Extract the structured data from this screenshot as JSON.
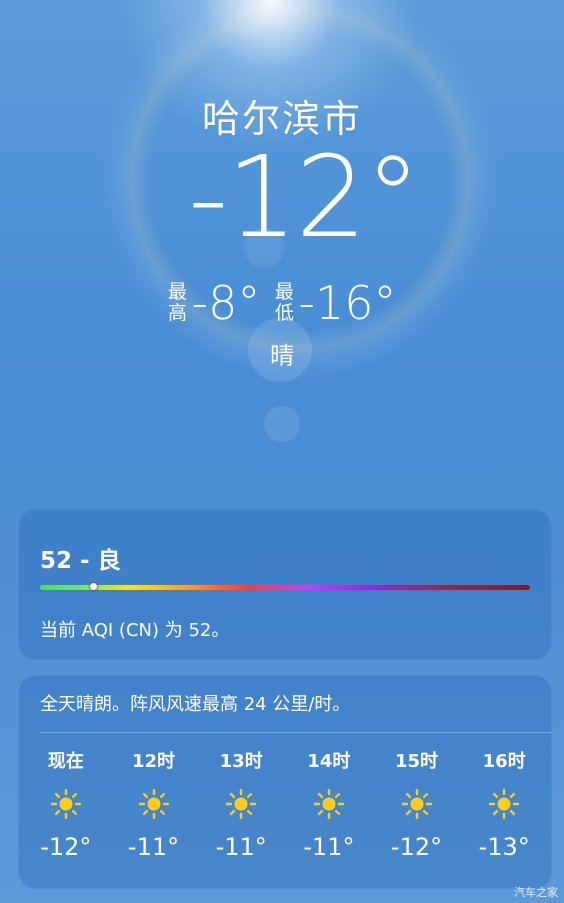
{
  "header": {
    "city": "哈尔滨市",
    "temperature": "-12°",
    "high_label": "最高",
    "high": "-8°",
    "low_label": "最低",
    "low": "-16°",
    "condition": "晴"
  },
  "aqi": {
    "value_text": "52 - 良",
    "description": "当前 AQI (CN) 为 52。",
    "level_fraction": 0.11
  },
  "forecast": {
    "summary": "全天晴朗。阵风风速最高 24 公里/时。",
    "hours": [
      {
        "label": "现在",
        "icon": "sun-icon",
        "temp": "-12°"
      },
      {
        "label": "12时",
        "icon": "sun-icon",
        "temp": "-11°"
      },
      {
        "label": "13时",
        "icon": "sun-icon",
        "temp": "-11°"
      },
      {
        "label": "14时",
        "icon": "sun-icon",
        "temp": "-11°"
      },
      {
        "label": "15时",
        "icon": "sun-icon",
        "temp": "-12°"
      },
      {
        "label": "16时",
        "icon": "sun-icon",
        "temp": "-13°"
      }
    ]
  },
  "watermark": "汽车之家",
  "colors": {
    "sun": "#ffcc1a"
  }
}
